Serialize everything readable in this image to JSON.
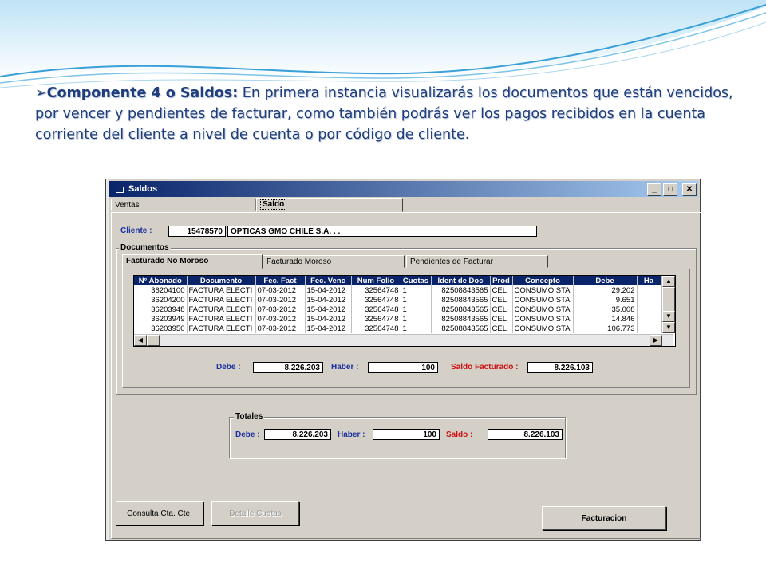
{
  "slide": {
    "bullet": "➢",
    "lead": "Componente 4 o Saldos:",
    "body": " En primera instancia visualizarás los documentos que están vencidos, por vencer y pendientes de facturar, como también podrás ver los pagos recibidos en la cuenta corriente del cliente a nivel de cuenta o por código de cliente."
  },
  "window": {
    "title": "Saldos",
    "controls": {
      "minimize": "_",
      "maximize": "□",
      "close": "✕"
    },
    "tabs": [
      {
        "label": "Ventas"
      },
      {
        "label": "Saldo"
      }
    ],
    "cliente": {
      "label": "Cliente :",
      "code": "15478570",
      "name": "OPTICAS GMO CHILE S.A. . ."
    },
    "documentos": {
      "title": "Documentos",
      "tabs": [
        {
          "label": "Facturado No Moroso"
        },
        {
          "label": "Facturado Moroso"
        },
        {
          "label": "Pendientes de Facturar"
        }
      ],
      "columns": [
        "N° Abonado",
        "Documento",
        "Fec. Fact",
        "Fec. Venc",
        "Num Folio",
        "Cuotas",
        "Ident de Doc",
        "Prod",
        "Concepto",
        "Debe",
        "Ha"
      ],
      "rows": [
        [
          "36204100",
          "FACTURA ELECTI",
          "07-03-2012",
          "15-04-2012",
          "32564748",
          "1",
          "82508843565",
          "CEL",
          "CONSUMO STA",
          "29.202",
          ""
        ],
        [
          "36204200",
          "FACTURA ELECTI",
          "07-03-2012",
          "15-04-2012",
          "32564748",
          "1",
          "82508843565",
          "CEL",
          "CONSUMO STA",
          "9.651",
          ""
        ],
        [
          "36203948",
          "FACTURA ELECTI",
          "07-03-2012",
          "15-04-2012",
          "32564748",
          "1",
          "82508843565",
          "CEL",
          "CONSUMO STA",
          "35.008",
          ""
        ],
        [
          "36203949",
          "FACTURA ELECTI",
          "07-03-2012",
          "15-04-2012",
          "32564748",
          "1",
          "82508843565",
          "CEL",
          "CONSUMO STA",
          "14.846",
          ""
        ],
        [
          "36203950",
          "FACTURA ELECTI",
          "07-03-2012",
          "15-04-2012",
          "32564748",
          "1",
          "82508843565",
          "CEL",
          "CONSUMO STA",
          "106.773",
          ""
        ]
      ],
      "debe_label": "Debe :",
      "debe": "8.226.203",
      "haber_label": "Haber :",
      "haber": "100",
      "saldo_label": "Saldo Facturado :",
      "saldo": "8.226.103"
    },
    "totales": {
      "title": "Totales",
      "debe_label": "Debe :",
      "debe": "8.226.203",
      "haber_label": "Haber :",
      "haber": "100",
      "saldo_label": "Saldo :",
      "saldo": "8.226.103"
    },
    "buttons": {
      "consulta": "Consulta Cta. Cte.",
      "detalle": "Detalle Cuotas",
      "facturacion": "Facturacion"
    },
    "colors": {
      "title_bar": "#0a246a",
      "label_blue": "#1a2fa0",
      "label_red": "#cc1111",
      "slide_text": "#1f3d7a"
    }
  }
}
